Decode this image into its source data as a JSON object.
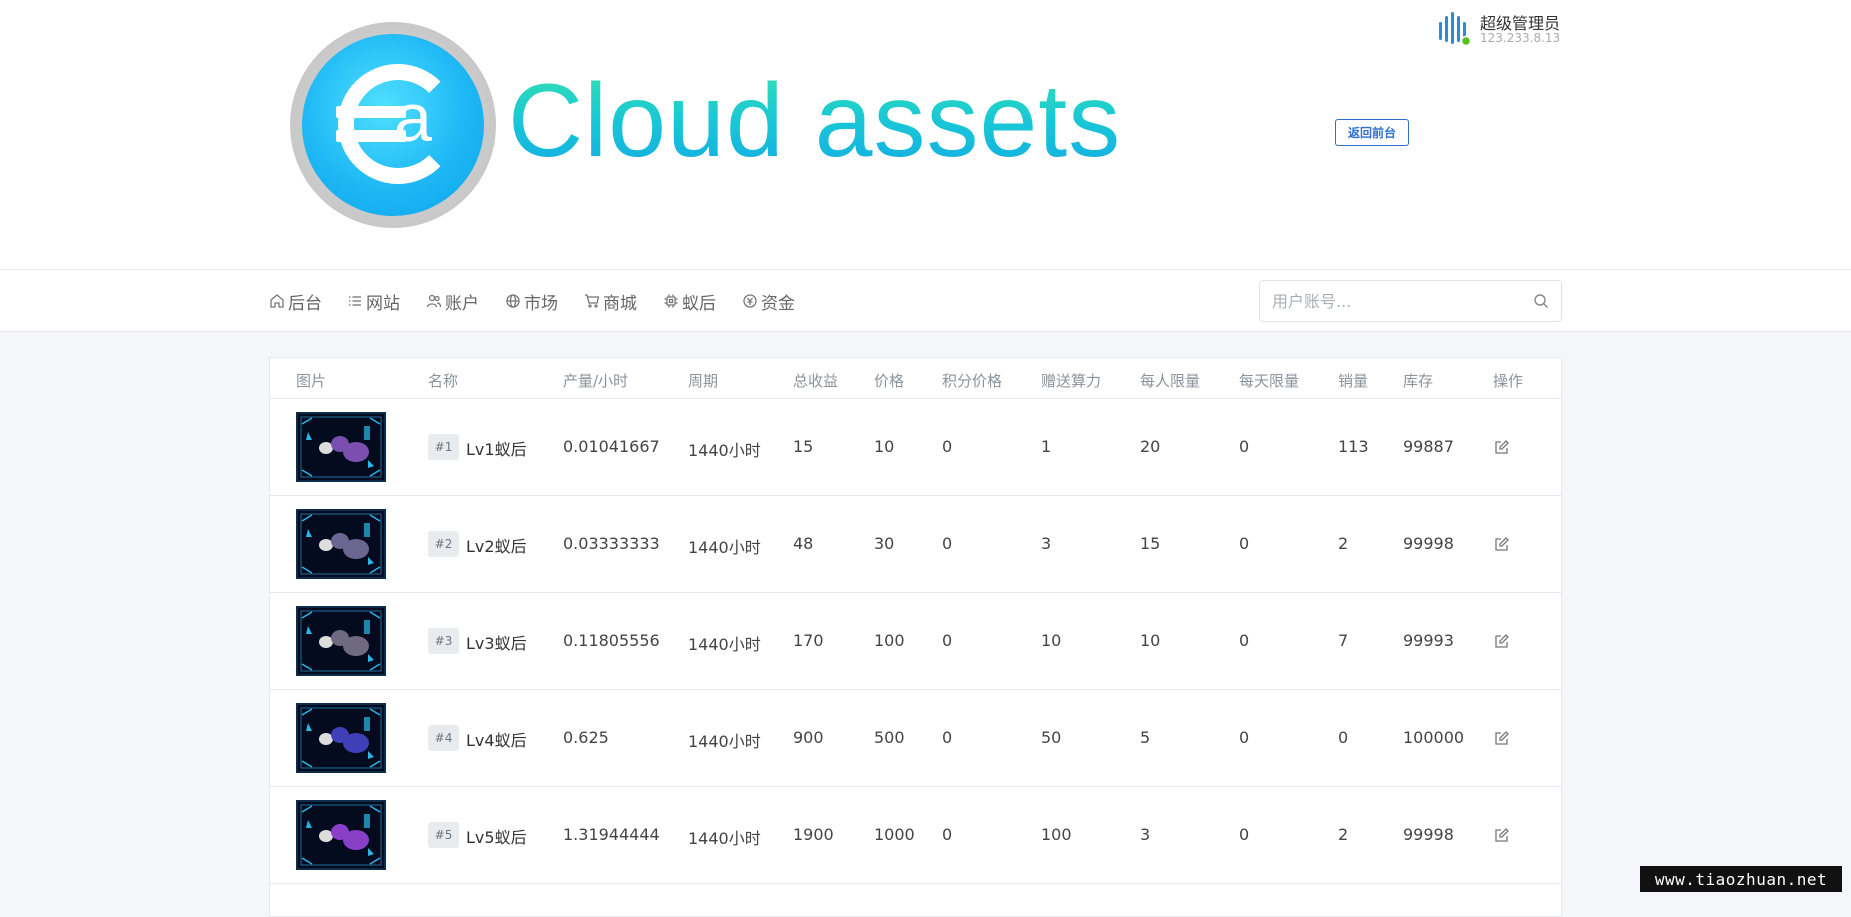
{
  "header": {
    "brand_text": "Cloud  assets",
    "back_button_label": "返回前台",
    "user": {
      "name": "超级管理员",
      "ip": "123.233.8.13"
    }
  },
  "nav": {
    "items": [
      {
        "label": "后台",
        "icon": "home-icon"
      },
      {
        "label": "网站",
        "icon": "list-icon"
      },
      {
        "label": "账户",
        "icon": "users-icon"
      },
      {
        "label": "市场",
        "icon": "globe-icon"
      },
      {
        "label": "商城",
        "icon": "cart-icon"
      },
      {
        "label": "蚁后",
        "icon": "chip-icon"
      },
      {
        "label": "资金",
        "icon": "coin-icon"
      }
    ],
    "search": {
      "placeholder": "用户账号...",
      "value": ""
    }
  },
  "table": {
    "columns": [
      "图片",
      "名称",
      "产量/小时",
      "周期",
      "总收益",
      "价格",
      "积分价格",
      "赠送算力",
      "每人限量",
      "每天限量",
      "销量",
      "库存",
      "操作"
    ],
    "rows": [
      {
        "id": "#1",
        "name": "Lv1蚁后",
        "output": "0.01041667",
        "cycle": "1440小时",
        "total": "15",
        "price": "10",
        "points_price": "0",
        "bonus_power": "1",
        "per_user_limit": "20",
        "daily_limit": "0",
        "sales": "113",
        "stock": "99887",
        "thumb_color": "#7a4fb0"
      },
      {
        "id": "#2",
        "name": "Lv2蚁后",
        "output": "0.03333333",
        "cycle": "1440小时",
        "total": "48",
        "price": "30",
        "points_price": "0",
        "bonus_power": "3",
        "per_user_limit": "15",
        "daily_limit": "0",
        "sales": "2",
        "stock": "99998",
        "thumb_color": "#6a6690"
      },
      {
        "id": "#3",
        "name": "Lv3蚁后",
        "output": "0.11805556",
        "cycle": "1440小时",
        "total": "170",
        "price": "100",
        "points_price": "0",
        "bonus_power": "10",
        "per_user_limit": "10",
        "daily_limit": "0",
        "sales": "7",
        "stock": "99993",
        "thumb_color": "#6f6a80"
      },
      {
        "id": "#4",
        "name": "Lv4蚁后",
        "output": "0.625",
        "cycle": "1440小时",
        "total": "900",
        "price": "500",
        "points_price": "0",
        "bonus_power": "50",
        "per_user_limit": "5",
        "daily_limit": "0",
        "sales": "0",
        "stock": "100000",
        "thumb_color": "#3f3fb8"
      },
      {
        "id": "#5",
        "name": "Lv5蚁后",
        "output": "1.31944444",
        "cycle": "1440小时",
        "total": "1900",
        "price": "1000",
        "points_price": "0",
        "bonus_power": "100",
        "per_user_limit": "3",
        "daily_limit": "0",
        "sales": "2",
        "stock": "99998",
        "thumb_color": "#8a3fc8"
      }
    ]
  },
  "watermark": "www.tiaozhuan.net",
  "colors": {
    "accent_blue": "#2f6fd1",
    "brand_gradient_top": "#35e2b0",
    "brand_gradient_bottom": "#13a9e6",
    "status_online": "#52c41a"
  }
}
